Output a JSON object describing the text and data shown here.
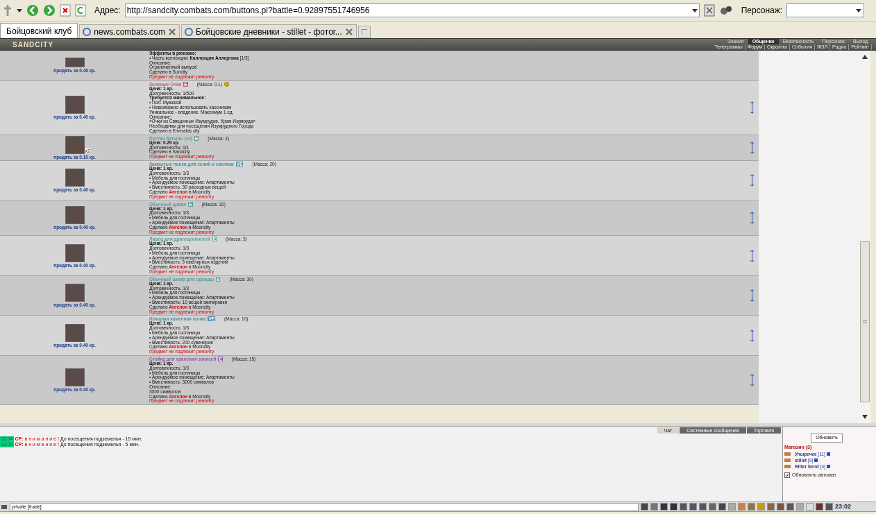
{
  "browser": {
    "address_label": "Адрес:",
    "url": "http://sandcity.combats.com/buttons.pl?battle=0.92897551746956",
    "profile_label": "Персонаж:"
  },
  "tabs": [
    {
      "label": "Бойцовский клуб",
      "selected": true
    },
    {
      "label": "news.combats.com",
      "selected": false
    },
    {
      "label": "Бойцовские дневники - stillet - фотог...",
      "selected": false
    }
  ],
  "game_header": {
    "logo": "SANDCITY",
    "menu_top": [
      {
        "label": "Знания",
        "selected": false
      },
      {
        "label": "Общение",
        "selected": true
      },
      {
        "label": "Безопасность",
        "selected": false
      },
      {
        "label": "Персонаж",
        "selected": false
      },
      {
        "label": "Выход",
        "selected": false
      }
    ],
    "menu_bottom": [
      "Телеграммы",
      "Форум",
      "Скроллы",
      "События",
      "ЖЗЛ",
      "Радио",
      "Рейтинг"
    ]
  },
  "items": [
    {
      "price": "продать за 0.46 кр.",
      "medal": false,
      "lines": [
        {
          "kind": "bold",
          "text": "Эффекты в рюкзаке:"
        },
        {
          "kind": "text",
          "text": "• Часть коллекции: **Коллекция Аллергика** [1/3]"
        },
        {
          "kind": "small",
          "text": "Описание:"
        },
        {
          "kind": "small",
          "text": "Ограниченный выпуск!"
        },
        {
          "kind": "small",
          "text": "Сделано в Suncity"
        },
        {
          "kind": "warn",
          "text": "Предмет не подлежит ремонту"
        }
      ]
    },
    {
      "price": "продать за 0.40 кр.",
      "name": "Зеленые Очки",
      "badge": "E",
      "mass": "(Масса: 0.1)",
      "color": "#c06080",
      "medal": true,
      "lines": [
        {
          "kind": "bold",
          "text": "Цена: 1 кр."
        },
        {
          "kind": "text",
          "text": "Долговечность: 1/500"
        },
        {
          "kind": "bold",
          "text": "Требуется минимальное:"
        },
        {
          "kind": "text",
          "text": "• Пол: Мужской"
        },
        {
          "kind": "text",
          "text": "• Невозможно использовать хаосникам"
        },
        {
          "kind": "text",
          "text": "Уникальное - владение. Максимум 1 ед."
        },
        {
          "kind": "small",
          "text": "Описание:"
        },
        {
          "kind": "small",
          "text": "«Очки из Священных Изумрудов. Храм Изумруда»"
        },
        {
          "kind": "small",
          "text": "Необходимы для посещения Изумрудного Города"
        },
        {
          "kind": "small",
          "text": "Сделано в Emeralds city"
        }
      ]
    },
    {
      "price": "продать за 0.10 кр.",
      "name": "Пустая бутыль (x2)",
      "badge": "E",
      "mass": "(Масса: 2)",
      "quantity": "x2",
      "color": "#5f9ea0",
      "medal": false,
      "lines": [
        {
          "kind": "bold",
          "text": "Цена: 0.20 кр."
        },
        {
          "kind": "text",
          "text": "Долговечность: 0/1"
        },
        {
          "kind": "small",
          "text": "Сделано в Sandcity"
        },
        {
          "kind": "warn",
          "text": "Предмет не подлежит ремонту"
        }
      ]
    },
    {
      "price": "продать за 0.40 кр.",
      "name": "Закрытые полки для зелий и свитков",
      "badge": "VE",
      "mass": "(Масса: 20)",
      "color": "#4f8fa8",
      "medal": false,
      "lines": [
        {
          "kind": "bold",
          "text": "Цена: 1 кр."
        },
        {
          "kind": "text",
          "text": "Долговечность: 1/3"
        },
        {
          "kind": "text",
          "text": "• Мебель для гостиницы"
        },
        {
          "kind": "text",
          "text": "• Арендуемое помещение: Апартаменты"
        },
        {
          "kind": "text",
          "text": "• Вместимость: 30 расходных вещей"
        },
        {
          "kind": "made",
          "text": "Сделано",
          "maker": "Ангелон",
          "place": "в Mooncity"
        },
        {
          "kind": "warn",
          "text": "Предмет не подлежит ремонту"
        }
      ]
    },
    {
      "price": "продать за 0.40 кр.",
      "name": "Обычный диван",
      "badge": "E",
      "mass": "(Масса: 30)",
      "color": "#5f9ea0",
      "medal": false,
      "lines": [
        {
          "kind": "bold",
          "text": "Цена: 1 кр."
        },
        {
          "kind": "text",
          "text": "Долговечность: 1/3"
        },
        {
          "kind": "text",
          "text": "• Мебель для гостиницы"
        },
        {
          "kind": "text",
          "text": "• Арендуемое помещение: Апартаменты"
        },
        {
          "kind": "made",
          "text": "Сделано",
          "maker": "Ангелон",
          "place": "в Mooncity"
        },
        {
          "kind": "warn",
          "text": "Предмет не подлежит ремонту"
        }
      ]
    },
    {
      "price": "продать за 0.40 кр.",
      "name": "Ларец для драгоценностей",
      "badge": "E",
      "mass": "(Масса: 3)",
      "color": "#5f9ea0",
      "medal": false,
      "lines": [
        {
          "kind": "bold",
          "text": "Цена: 1 кр."
        },
        {
          "kind": "text",
          "text": "Долговечность: 1/3"
        },
        {
          "kind": "text",
          "text": "• Мебель для гостиницы"
        },
        {
          "kind": "text",
          "text": "• Арендуемое помещение: Апартаменты"
        },
        {
          "kind": "text",
          "text": "• Вместимость: 5 ювелирных изделий"
        },
        {
          "kind": "made",
          "text": "Сделано",
          "maker": "Ангелон",
          "place": "в Mooncity"
        },
        {
          "kind": "warn",
          "text": "Предмет не подлежит ремонту"
        }
      ]
    },
    {
      "price": "продать за 0.40 кр.",
      "name": "Обычный шкаф для одежды",
      "badge": "E",
      "mass": "(Масса: 30)",
      "color": "#5f9ea0",
      "medal": false,
      "lines": [
        {
          "kind": "bold",
          "text": "Цена: 1 кр."
        },
        {
          "kind": "text",
          "text": "Долговечность: 1/3"
        },
        {
          "kind": "text",
          "text": "• Мебель для гостиницы"
        },
        {
          "kind": "text",
          "text": "• Арендуемое помещение: Апартаменты"
        },
        {
          "kind": "text",
          "text": "• Вместимость: 10 вещей экипировки"
        },
        {
          "kind": "made",
          "text": "Сделано",
          "maker": "Ангелон",
          "place": "в Mooncity"
        },
        {
          "kind": "warn",
          "text": "Предмет не подлежит ремонту"
        }
      ]
    },
    {
      "price": "продать за 0.40 кр.",
      "name": "Изящная каменная полка",
      "badge": "VE",
      "mass": "(Масса: 10)",
      "color": "#4f8fa8",
      "medal": false,
      "lines": [
        {
          "kind": "bold",
          "text": "Цена: 1 кр."
        },
        {
          "kind": "text",
          "text": "Долговечность: 1/3"
        },
        {
          "kind": "text",
          "text": "• Мебель для гостиницы"
        },
        {
          "kind": "text",
          "text": "• Арендуемое помещение: Апартаменты"
        },
        {
          "kind": "text",
          "text": "• Вместимость: 200 сувениров"
        },
        {
          "kind": "made",
          "text": "Сделано",
          "maker": "Ангелон",
          "place": "в Mooncity"
        },
        {
          "kind": "warn",
          "text": "Предмет не подлежит ремонту"
        }
      ]
    },
    {
      "price": "продать за 0.40 кр.",
      "name": "Стойка для хранения записей",
      "badge": "E",
      "mass": "(Масса: 15)",
      "color": "#9060b0",
      "medal": false,
      "lines": [
        {
          "kind": "bold",
          "text": "Цена: 1 кр."
        },
        {
          "kind": "text",
          "text": "Долговечность: 1/3"
        },
        {
          "kind": "text",
          "text": "• Мебель для гостиницы"
        },
        {
          "kind": "text",
          "text": "• Арендуемое помещение: Апартаменты"
        },
        {
          "kind": "text",
          "text": "• Вместимость: 3000 символов"
        },
        {
          "kind": "small",
          "text": "Описание:"
        },
        {
          "kind": "small",
          "text": "3000 символов"
        },
        {
          "kind": "made",
          "text": "Сделано",
          "maker": "Ангелон",
          "place": "в Mooncity"
        },
        {
          "kind": "warn",
          "text": "Предмет не подлежит ремонту"
        }
      ]
    }
  ],
  "chat": {
    "tabs": [
      {
        "label": "Чат",
        "selected": true
      },
      {
        "label": "Системные сообщения",
        "selected": false
      },
      {
        "label": "Торговля",
        "selected": false
      }
    ],
    "messages": [
      {
        "time": "02:04",
        "sender": "СР:",
        "alert": "в н и м а н и е !",
        "text": "До посещения подземелья - 15 мин."
      },
      {
        "time": "02:09",
        "sender": "СР:",
        "alert": "в н и м а н и е !",
        "text": "До посещения подземелья - 5 мин."
      }
    ],
    "input_value": "private [trade]",
    "clock": "23:02"
  },
  "online_panel": {
    "refresh_button": "Обновить",
    "room": "Магазин (3)",
    "users": [
      {
        "name": "Упыречек",
        "level": "[11]"
      },
      {
        "name": "stillet",
        "level": "[9]"
      },
      {
        "name": "Ritter Send",
        "level": "[4]"
      }
    ],
    "auto_refresh": {
      "label": "Обновлять автомат.",
      "checked": true
    }
  }
}
